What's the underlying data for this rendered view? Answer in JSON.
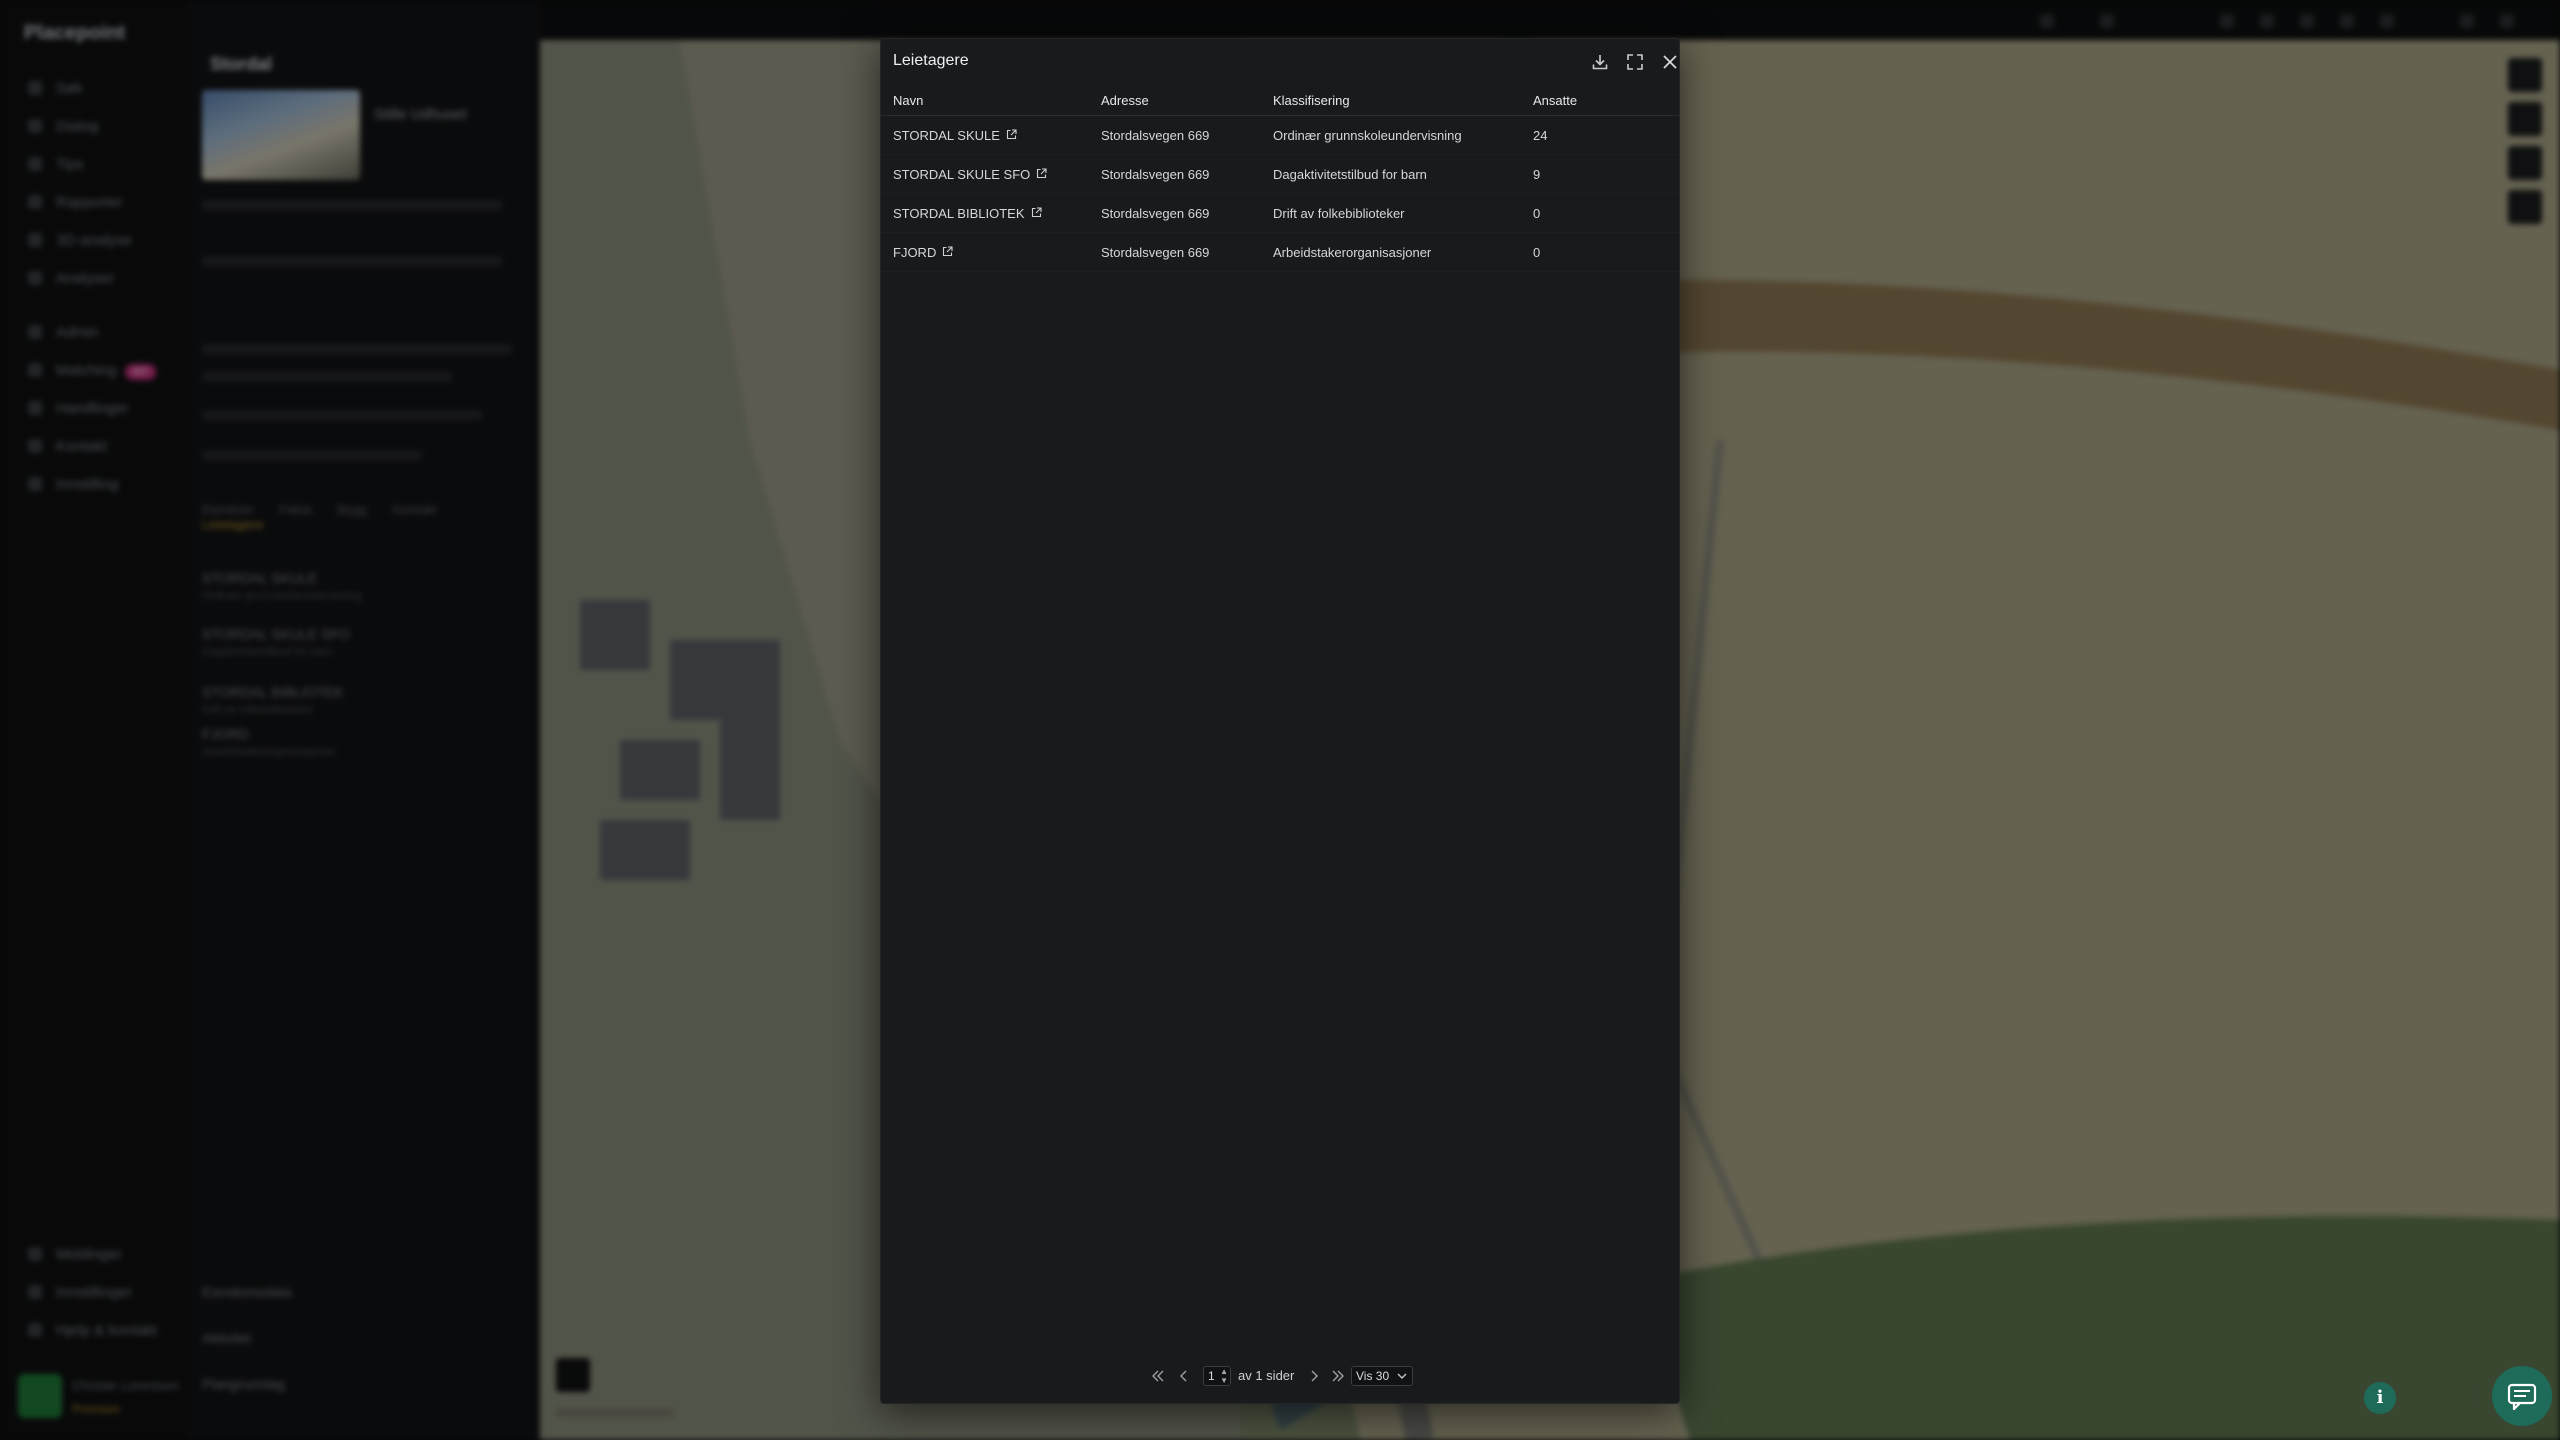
{
  "app": {
    "logo_text": "Placepoint",
    "nav_items": [
      "Søk",
      "Dialog",
      "Tips",
      "Rapporter",
      "3D-analyse",
      "Analyser",
      "Admin",
      "Matching",
      "Handlinger",
      "Kontakt",
      "Innstilling"
    ],
    "nav_badge": "NY",
    "footer_items": [
      "Meldinger",
      "Innstillinger",
      "Hjelp & kontakt"
    ],
    "user_name": "Christer Lorentzen",
    "user_role": "Premium"
  },
  "side_panel": {
    "title": "Stordal",
    "subtitle": "Stille Udhuset",
    "tabs": [
      "Eiendom",
      "Fakta",
      "Bygg",
      "Kontakt",
      "Leietagere"
    ],
    "active_tab": "Leietagere",
    "list": [
      {
        "name": "STORDAL SKULE",
        "desc": "Ordinær grunnskoleundervisning"
      },
      {
        "name": "STORDAL SKULE SFO",
        "desc": "Dagaktivitetstilbud for barn"
      },
      {
        "name": "STORDAL BIBLIOTEK",
        "desc": "Drift av folkebiblioteker"
      },
      {
        "name": "FJORD",
        "desc": "Arbeidstakerorganisasjoner"
      }
    ],
    "bottom_rows": [
      "Eiendomsdata",
      "Aktivitet",
      "Plangrunnlag"
    ]
  },
  "modal": {
    "title": "Leietagere",
    "download_icon": "download-icon",
    "expand_icon": "expand-icon",
    "close_icon": "close-icon",
    "columns": {
      "name": "Navn",
      "address": "Adresse",
      "classification": "Klassifisering",
      "employees": "Ansatte"
    },
    "rows": [
      {
        "name": "STORDAL SKULE",
        "address": "Stordalsvegen 669",
        "classification": "Ordinær grunnskoleundervisning",
        "employees": "24"
      },
      {
        "name": "STORDAL SKULE SFO",
        "address": "Stordalsvegen 669",
        "classification": "Dagaktivitetstilbud for barn",
        "employees": "9"
      },
      {
        "name": "STORDAL BIBLIOTEK",
        "address": "Stordalsvegen 669",
        "classification": "Drift av folkebiblioteker",
        "employees": "0"
      },
      {
        "name": "FJORD",
        "address": "Stordalsvegen 669",
        "classification": "Arbeidstakerorganisasjoner",
        "employees": "0"
      }
    ],
    "pagination": {
      "page": "1",
      "of_text": "av 1 sider",
      "page_size": "Vis 30"
    }
  },
  "colors": {
    "modal_bg": "#181a1c",
    "accent_green": "#1e6b5a",
    "map_field": "#a9a387"
  }
}
